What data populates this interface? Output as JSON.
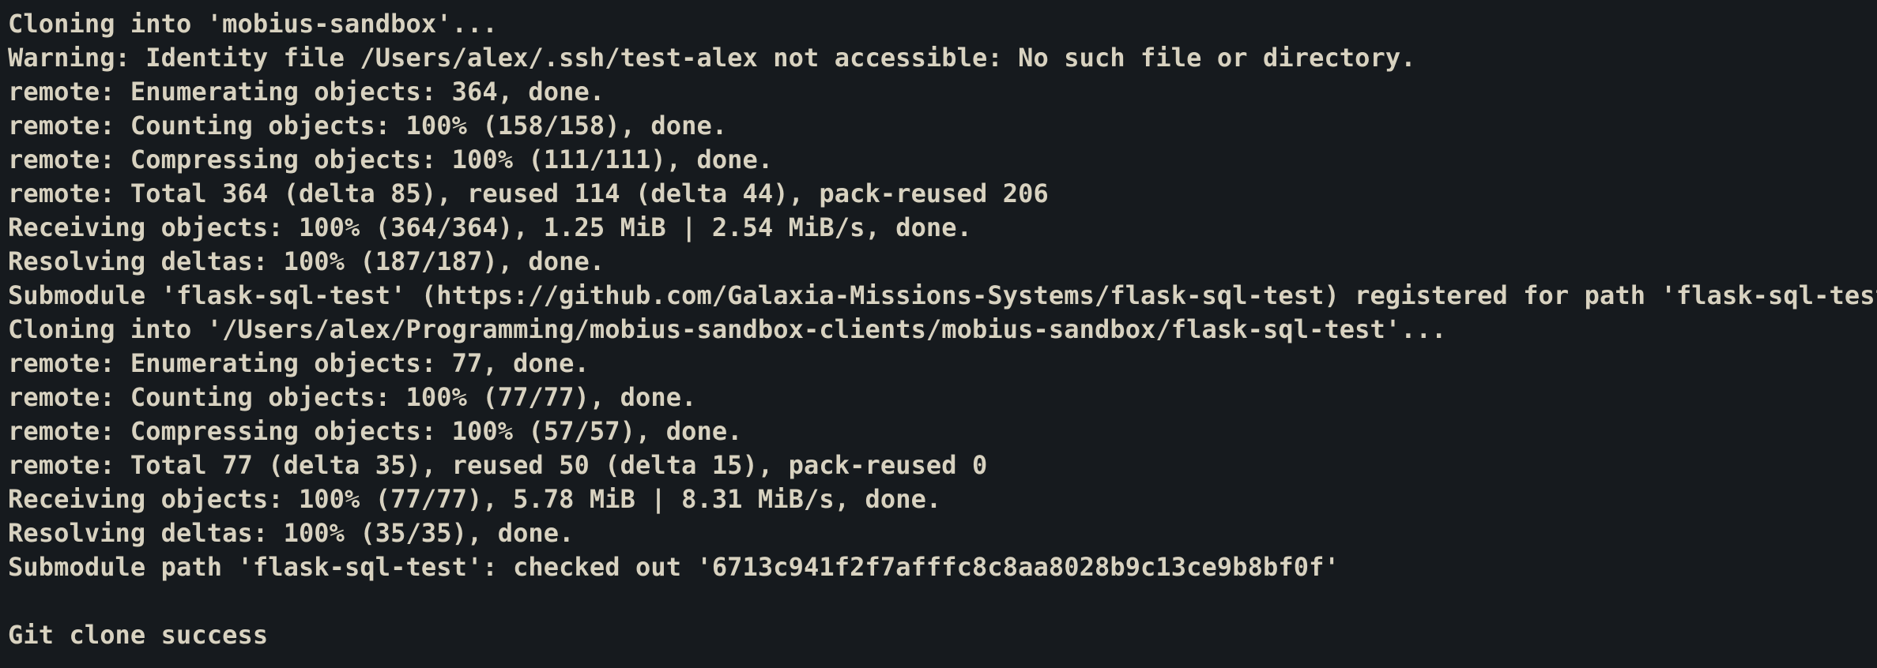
{
  "terminal": {
    "text_color": "#d8d2c0",
    "background": "#161a1e",
    "lines": [
      "Cloning into 'mobius-sandbox'...",
      "Warning: Identity file /Users/alex/.ssh/test-alex not accessible: No such file or directory.",
      "remote: Enumerating objects: 364, done.",
      "remote: Counting objects: 100% (158/158), done.",
      "remote: Compressing objects: 100% (111/111), done.",
      "remote: Total 364 (delta 85), reused 114 (delta 44), pack-reused 206",
      "Receiving objects: 100% (364/364), 1.25 MiB | 2.54 MiB/s, done.",
      "Resolving deltas: 100% (187/187), done.",
      "Submodule 'flask-sql-test' (https://github.com/Galaxia-Missions-Systems/flask-sql-test) registered for path 'flask-sql-test'",
      "Cloning into '/Users/alex/Programming/mobius-sandbox-clients/mobius-sandbox/flask-sql-test'...",
      "remote: Enumerating objects: 77, done.",
      "remote: Counting objects: 100% (77/77), done.",
      "remote: Compressing objects: 100% (57/57), done.",
      "remote: Total 77 (delta 35), reused 50 (delta 15), pack-reused 0",
      "Receiving objects: 100% (77/77), 5.78 MiB | 8.31 MiB/s, done.",
      "Resolving deltas: 100% (35/35), done.",
      "Submodule path 'flask-sql-test': checked out '6713c941f2f7afffc8c8aa8028b9c13ce9b8bf0f'",
      "",
      "Git clone success"
    ]
  }
}
